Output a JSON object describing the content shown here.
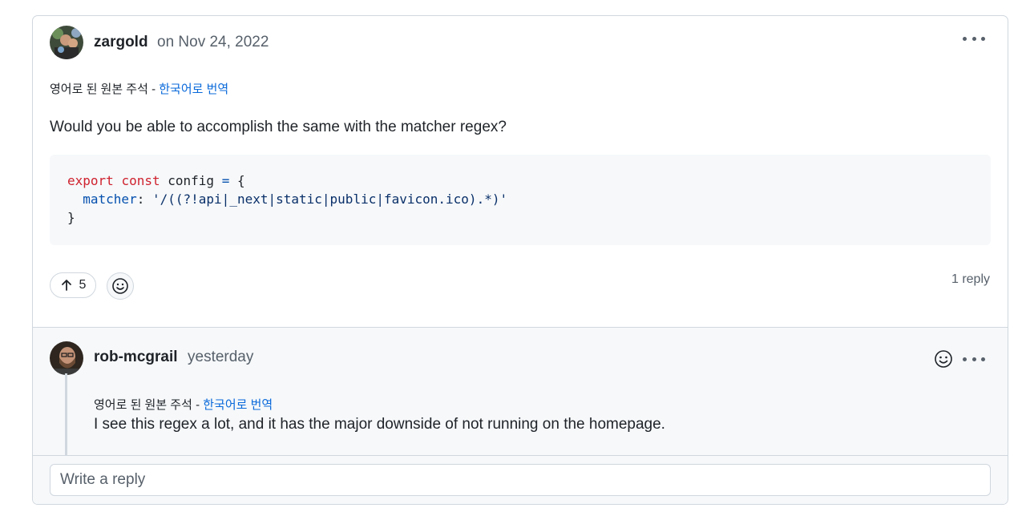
{
  "comment": {
    "author": "zargold",
    "timestamp": "on Nov 24, 2022",
    "translation_note": "영어로 된 원본 주석 -",
    "translate_link": "한국어로 번역",
    "body": "Would you be able to accomplish the same with the matcher regex?",
    "code": {
      "line1_kw1": "export",
      "line1_kw2": "const",
      "line1_ident": "config",
      "line1_op": "=",
      "line1_brace": "{",
      "line2_prop": "matcher",
      "line2_colon": ":",
      "line2_str": "'/((?!api|_next|static|public|favicon.ico).*)'",
      "line3": "}"
    },
    "upvotes": "5",
    "reply_count": "1 reply",
    "upvote_icon": "arrow-up-icon",
    "react_icon": "smiley-icon",
    "menu_icon": "kebab-horizontal-icon"
  },
  "reply": {
    "author": "rob-mcgrail",
    "timestamp": "yesterday",
    "translation_note": "영어로 된 원본 주석 -",
    "translate_link": "한국어로 번역",
    "body": "I see this regex a lot, and it has the major downside of not running on the homepage.",
    "react_icon": "smiley-icon",
    "menu_icon": "kebab-horizontal-icon"
  },
  "reply_input": {
    "placeholder": "Write a reply"
  },
  "colors": {
    "link": "#0969da",
    "border": "#d0d7de",
    "muted": "#57606a",
    "code_bg": "#f6f8fa"
  }
}
